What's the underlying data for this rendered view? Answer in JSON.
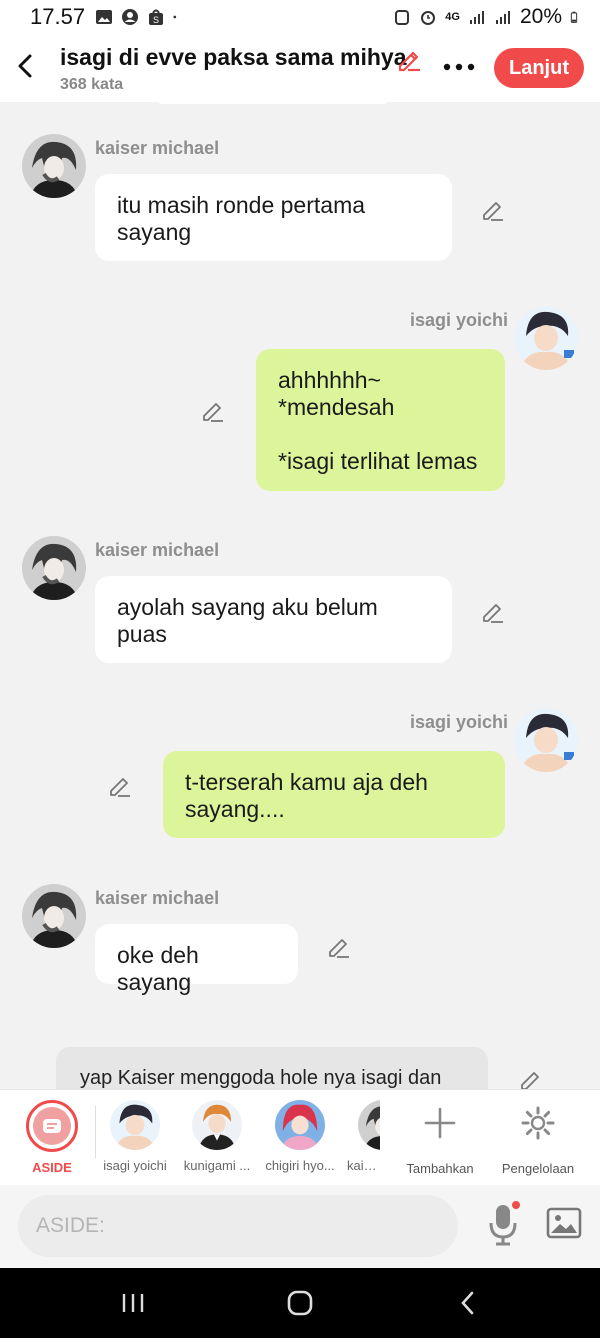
{
  "status_bar": {
    "time": "17.57",
    "battery": "20%",
    "network": "4G"
  },
  "header": {
    "title": "isagi di evve paksa sama mihya",
    "word_count": "368 kata",
    "next_button": "Lanjut"
  },
  "messages": [
    {
      "speaker": "kaiser michael",
      "side": "left",
      "text": "itu masih ronde pertama\nsayang"
    },
    {
      "speaker": "isagi yoichi",
      "side": "right",
      "text": "ahhhhhh~\n*mendesah\n\n*isagi terlihat lemas"
    },
    {
      "speaker": "kaiser michael",
      "side": "left",
      "text": "ayolah sayang aku belum\npuas"
    },
    {
      "speaker": "isagi yoichi",
      "side": "right",
      "text": "t-terserah kamu aja deh\nsayang...."
    },
    {
      "speaker": "kaiser michael",
      "side": "left",
      "text": "oke deh sayang"
    }
  ],
  "narration": "yap Kaiser menggoda hole nya isagi dan",
  "character_bar": {
    "aside_label": "ASIDE",
    "characters": [
      "isagi yoichi",
      "kunigami ...",
      "chigiri hyo...",
      "kaiser"
    ],
    "add_label": "Tambahkan",
    "manage_label": "Pengelolaan"
  },
  "input": {
    "placeholder": "ASIDE:"
  },
  "colors": {
    "accent": "#f04a4a",
    "right_bubble": "#dcf59a",
    "left_bubble": "#ffffff"
  },
  "icons": [
    "back-arrow-icon",
    "pencil-icon",
    "more-icon",
    "mic-icon",
    "image-icon",
    "plus-icon",
    "gear-icon"
  ]
}
